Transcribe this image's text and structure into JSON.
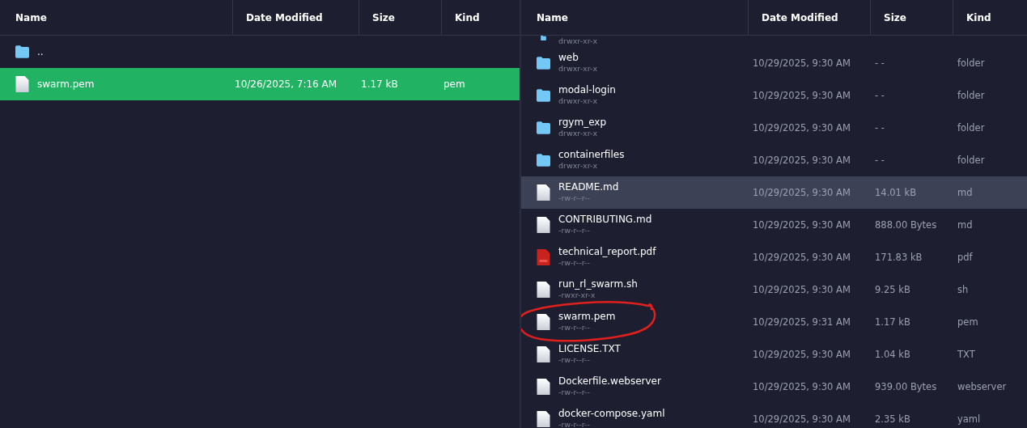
{
  "left_pane": {
    "columns": [
      "Name",
      "Date Modified",
      "Size",
      "Kind"
    ],
    "rows": [
      {
        "kind": "folder",
        "name": "..",
        "selected": false
      },
      {
        "kind": "file",
        "name": "swarm.pem",
        "date": "10/26/2025, 7:16 AM",
        "size": "1.17 kB",
        "file_kind": "pem",
        "selected": true
      }
    ]
  },
  "right_pane": {
    "columns": [
      "Name",
      "Date Modified",
      "Size",
      "Kind"
    ],
    "rows": [
      {
        "kind": "folder",
        "perms": "drwxr-xr-x",
        "highlighted": false,
        "circled": false
      },
      {
        "kind": "folder",
        "name": "web",
        "perms": "drwxr-xr-x",
        "date": "10/29/2025, 9:30 AM",
        "size": "- -",
        "file_kind": "folder",
        "highlighted": false,
        "circled": false
      },
      {
        "kind": "folder",
        "name": "modal-login",
        "perms": "drwxr-xr-x",
        "date": "10/29/2025, 9:30 AM",
        "size": "- -",
        "file_kind": "folder",
        "highlighted": false,
        "circled": false
      },
      {
        "kind": "folder",
        "name": "rgym_exp",
        "perms": "drwxr-xr-x",
        "date": "10/29/2025, 9:30 AM",
        "size": "- -",
        "file_kind": "folder",
        "highlighted": false,
        "circled": false
      },
      {
        "kind": "folder",
        "name": "containerfiles",
        "perms": "drwxr-xr-x",
        "date": "10/29/2025, 9:30 AM",
        "size": "- -",
        "file_kind": "folder",
        "highlighted": false,
        "circled": false
      },
      {
        "kind": "file",
        "name": "README.md",
        "perms": "-rw-r--r--",
        "date": "10/29/2025, 9:30 AM",
        "size": "14.01 kB",
        "file_kind": "md",
        "highlighted": true,
        "circled": false
      },
      {
        "kind": "file",
        "name": "CONTRIBUTING.md",
        "perms": "-rw-r--r--",
        "date": "10/29/2025, 9:30 AM",
        "size": "888.00 Bytes",
        "file_kind": "md",
        "highlighted": false,
        "circled": false
      },
      {
        "kind": "pdf",
        "name": "technical_report.pdf",
        "perms": "-rw-r--r--",
        "date": "10/29/2025, 9:30 AM",
        "size": "171.83 kB",
        "file_kind": "pdf",
        "highlighted": false,
        "circled": false
      },
      {
        "kind": "file",
        "name": "run_rl_swarm.sh",
        "perms": "-rwxr-xr-x",
        "date": "10/29/2025, 9:30 AM",
        "size": "9.25 kB",
        "file_kind": "sh",
        "highlighted": false,
        "circled": false
      },
      {
        "kind": "file",
        "name": "swarm.pem",
        "perms": "-rw-r--r--",
        "date": "10/29/2025, 9:31 AM",
        "size": "1.17 kB",
        "file_kind": "pem",
        "highlighted": false,
        "circled": true
      },
      {
        "kind": "file",
        "name": "LICENSE.TXT",
        "perms": "-rw-r--r--",
        "date": "10/29/2025, 9:30 AM",
        "size": "1.04 kB",
        "file_kind": "TXT",
        "highlighted": false,
        "circled": false
      },
      {
        "kind": "file",
        "name": "Dockerfile.webserver",
        "perms": "-rw-r--r--",
        "date": "10/29/2025, 9:30 AM",
        "size": "939.00 Bytes",
        "file_kind": "webserver",
        "highlighted": false,
        "circled": false
      },
      {
        "kind": "file",
        "name": "docker-compose.yaml",
        "perms": "-rw-r--r--",
        "date": "10/29/2025, 9:30 AM",
        "size": "2.35 kB",
        "file_kind": "yaml",
        "highlighted": false,
        "circled": false
      }
    ]
  }
}
